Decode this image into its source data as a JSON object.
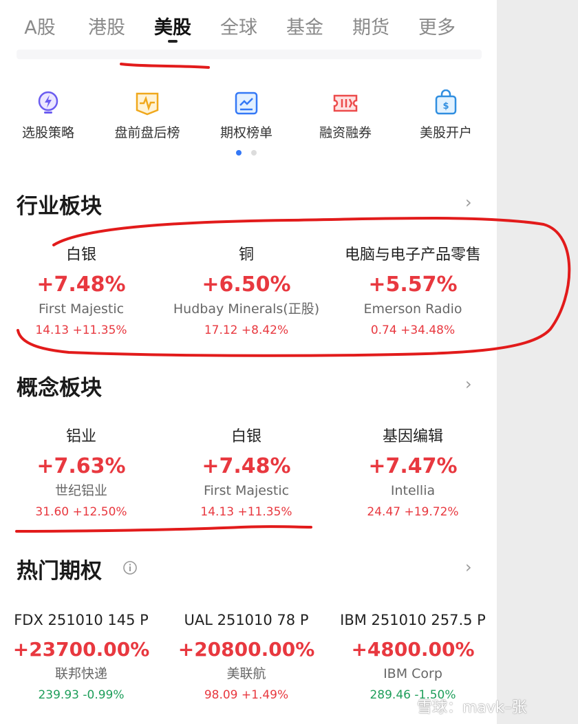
{
  "tabs": [
    {
      "label": "A股"
    },
    {
      "label": "港股"
    },
    {
      "label": "美股",
      "active": true
    },
    {
      "label": "全球"
    },
    {
      "label": "基金"
    },
    {
      "label": "期货"
    },
    {
      "label": "更多"
    }
  ],
  "actions": [
    {
      "label": "选股策略",
      "icon": "strategy-bulb-icon"
    },
    {
      "label": "盘前盘后榜",
      "icon": "premarket-chart-icon"
    },
    {
      "label": "期权榜单",
      "icon": "options-chart-icon"
    },
    {
      "label": "融资融券",
      "icon": "margin-ticket-icon"
    },
    {
      "label": "美股开户",
      "icon": "account-bag-icon"
    }
  ],
  "industry": {
    "title": "行业板块",
    "cards": [
      {
        "name": "白银",
        "pct": "+7.48%",
        "stock": "First Majestic",
        "sub": "14.13 +11.35%"
      },
      {
        "name": "铜",
        "pct": "+6.50%",
        "stock": "Hudbay Minerals(正股)",
        "sub": "17.12 +8.42%"
      },
      {
        "name": "电脑与电子产品零售",
        "pct": "+5.57%",
        "stock": "Emerson Radio",
        "sub": "0.74 +34.48%"
      }
    ]
  },
  "concept": {
    "title": "概念板块",
    "cards": [
      {
        "name": "铝业",
        "pct": "+7.63%",
        "stock": "世纪铝业",
        "sub": "31.60 +12.50%"
      },
      {
        "name": "白银",
        "pct": "+7.48%",
        "stock": "First Majestic",
        "sub": "14.13 +11.35%"
      },
      {
        "name": "基因编辑",
        "pct": "+7.47%",
        "stock": "Intellia",
        "sub": "24.47 +19.72%"
      }
    ]
  },
  "options": {
    "title": "热门期权",
    "cards": [
      {
        "name": "FDX 251010 145 P",
        "pct": "+23700.00%",
        "stock": "联邦快递",
        "sub": "239.93 -0.99%"
      },
      {
        "name": "UAL 251010 78 P",
        "pct": "+20800.00%",
        "stock": "美联航",
        "sub": "98.09 +1.49%"
      },
      {
        "name": "IBM 251010 257.5 P",
        "pct": "+4800.00%",
        "stock": "IBM Corp",
        "sub": "289.46 -1.50%"
      }
    ]
  },
  "chevron": "›",
  "watermark": "雪球：mavk–张",
  "colors": {
    "up": "#e8383f",
    "down": "#1e9e5a",
    "accent": "#3478f6",
    "annotation": "#e21b1b"
  }
}
